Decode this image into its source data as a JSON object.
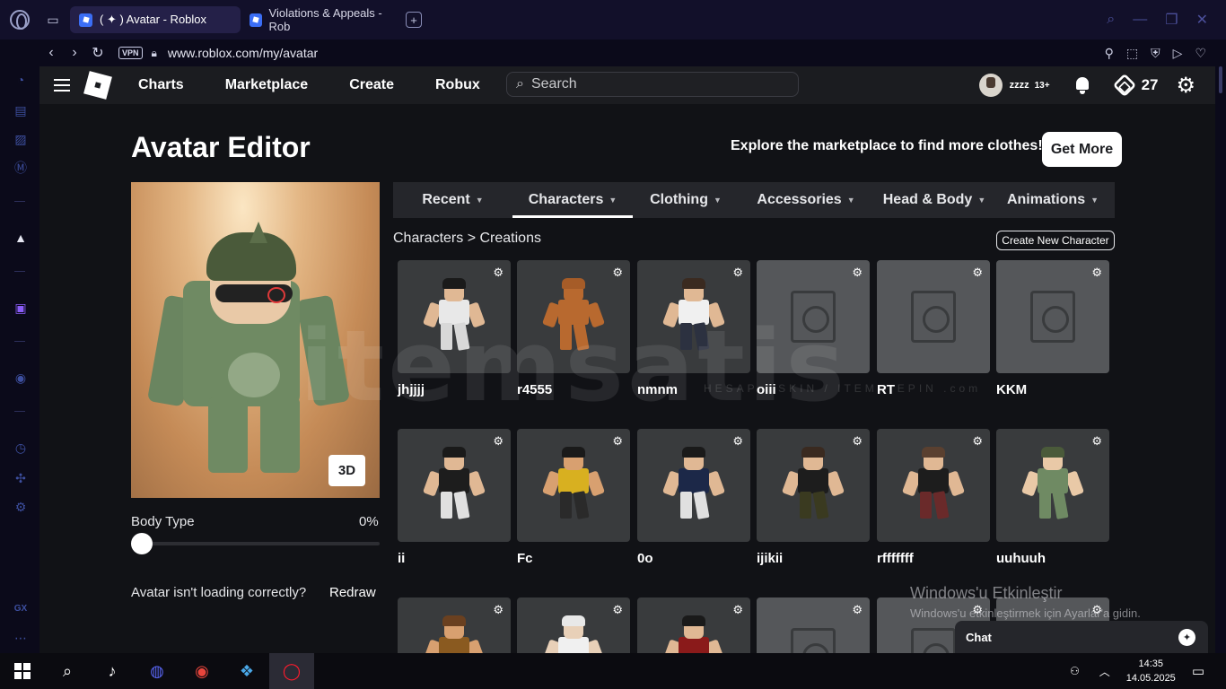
{
  "browser": {
    "tabs": [
      {
        "label": "( ✦ ) Avatar - Roblox",
        "active": true
      },
      {
        "label": "Violations & Appeals - Rob",
        "active": false
      }
    ],
    "url": "www.roblox.com/my/avatar",
    "vpn_label": "VPN"
  },
  "header": {
    "nav": [
      "Charts",
      "Marketplace",
      "Create",
      "Robux"
    ],
    "search_placeholder": "Search",
    "username": "zzzz",
    "age_badge": "13+",
    "robux": "27"
  },
  "editor": {
    "title": "Avatar Editor",
    "explore_text": "Explore the marketplace to find more clothes!",
    "get_more_label": "Get More",
    "btn_3d": "3D",
    "body_type_label": "Body Type",
    "body_type_value": "0%",
    "body_type_fraction": 0,
    "not_loading_text": "Avatar isn't loading correctly?",
    "redraw_label": "Redraw"
  },
  "categories": [
    {
      "label": "Recent",
      "active": false
    },
    {
      "label": "Characters",
      "active": true
    },
    {
      "label": "Clothing",
      "active": false
    },
    {
      "label": "Accessories",
      "active": false
    },
    {
      "label": "Head & Body",
      "active": false
    },
    {
      "label": "Animations",
      "active": false
    }
  ],
  "breadcrumb": {
    "root": "Characters",
    "separator": ">",
    "current": "Creations"
  },
  "create_new_label": "Create New Character",
  "characters": [
    {
      "name": "jhjjjj",
      "missing": false,
      "shirt": "#e8e8e8",
      "pants": "#d8d8d8",
      "hair": "#1a1a1a",
      "skin": "#e0b894"
    },
    {
      "name": "r4555",
      "missing": false,
      "shirt": "#b8692f",
      "pants": "#b8692f",
      "hair": "#a65c28",
      "skin": "#b8692f"
    },
    {
      "name": "nmnm",
      "missing": false,
      "shirt": "#f0f0f0",
      "pants": "#2c3140",
      "hair": "#3a2a20",
      "skin": "#e0b894"
    },
    {
      "name": "oiii",
      "missing": true
    },
    {
      "name": "RT",
      "missing": true
    },
    {
      "name": "KKM",
      "missing": true
    },
    {
      "name": "ii",
      "missing": false,
      "shirt": "#1d1d1d",
      "pants": "#e0e0e0",
      "hair": "#1a1a1a",
      "skin": "#e0b894"
    },
    {
      "name": "Fc",
      "missing": false,
      "shirt": "#d8b020",
      "pants": "#2a2a2a",
      "hair": "#1a1a1a",
      "skin": "#d8a070"
    },
    {
      "name": "0o",
      "missing": false,
      "shirt": "#1c2848",
      "pants": "#e0e0e0",
      "hair": "#1a1a1a",
      "skin": "#e0b894"
    },
    {
      "name": "ijikii",
      "missing": false,
      "shirt": "#1d1d1d",
      "pants": "#3a3a20",
      "hair": "#3a2a20",
      "skin": "#e0b894"
    },
    {
      "name": "rfffffff",
      "missing": false,
      "shirt": "#1d1d1d",
      "pants": "#6a2a2a",
      "hair": "#5a4030",
      "skin": "#e0b894"
    },
    {
      "name": "uuhuuh",
      "missing": false,
      "shirt": "#6f8a63",
      "pants": "#6f8a63",
      "hair": "#4a5a3a",
      "skin": "#e9c9a7"
    },
    {
      "name": "",
      "missing": false,
      "shirt": "#8a5a20",
      "pants": "#8a5a20",
      "hair": "#6a4020",
      "skin": "#d8a070"
    },
    {
      "name": "",
      "missing": false,
      "shirt": "#f0f0f0",
      "pants": "#f0f0f0",
      "hair": "#e8e8e8",
      "skin": "#e8d0b8"
    },
    {
      "name": "",
      "missing": false,
      "shirt": "#8a1a1a",
      "pants": "#2a2a2a",
      "hair": "#1a1a1a",
      "skin": "#e0b894"
    },
    {
      "name": "",
      "missing": true
    },
    {
      "name": "",
      "missing": true
    },
    {
      "name": "",
      "missing": true
    }
  ],
  "watermark": {
    "main": "itemsatis",
    "sub": "HESAP · SKIN / ITEM / EPIN",
    "com": ".com"
  },
  "windows": {
    "activate_title": "Windows'u Etkinleştir",
    "activate_sub": "Windows'u etkinleştirmek için Ayarlar'a gidin.",
    "time": "14:35",
    "date": "14.05.2025"
  },
  "chat": {
    "label": "Chat"
  },
  "colors": {
    "accent": "#ffffff",
    "page_bg": "#111216",
    "tile_bg": "#393b3d"
  }
}
